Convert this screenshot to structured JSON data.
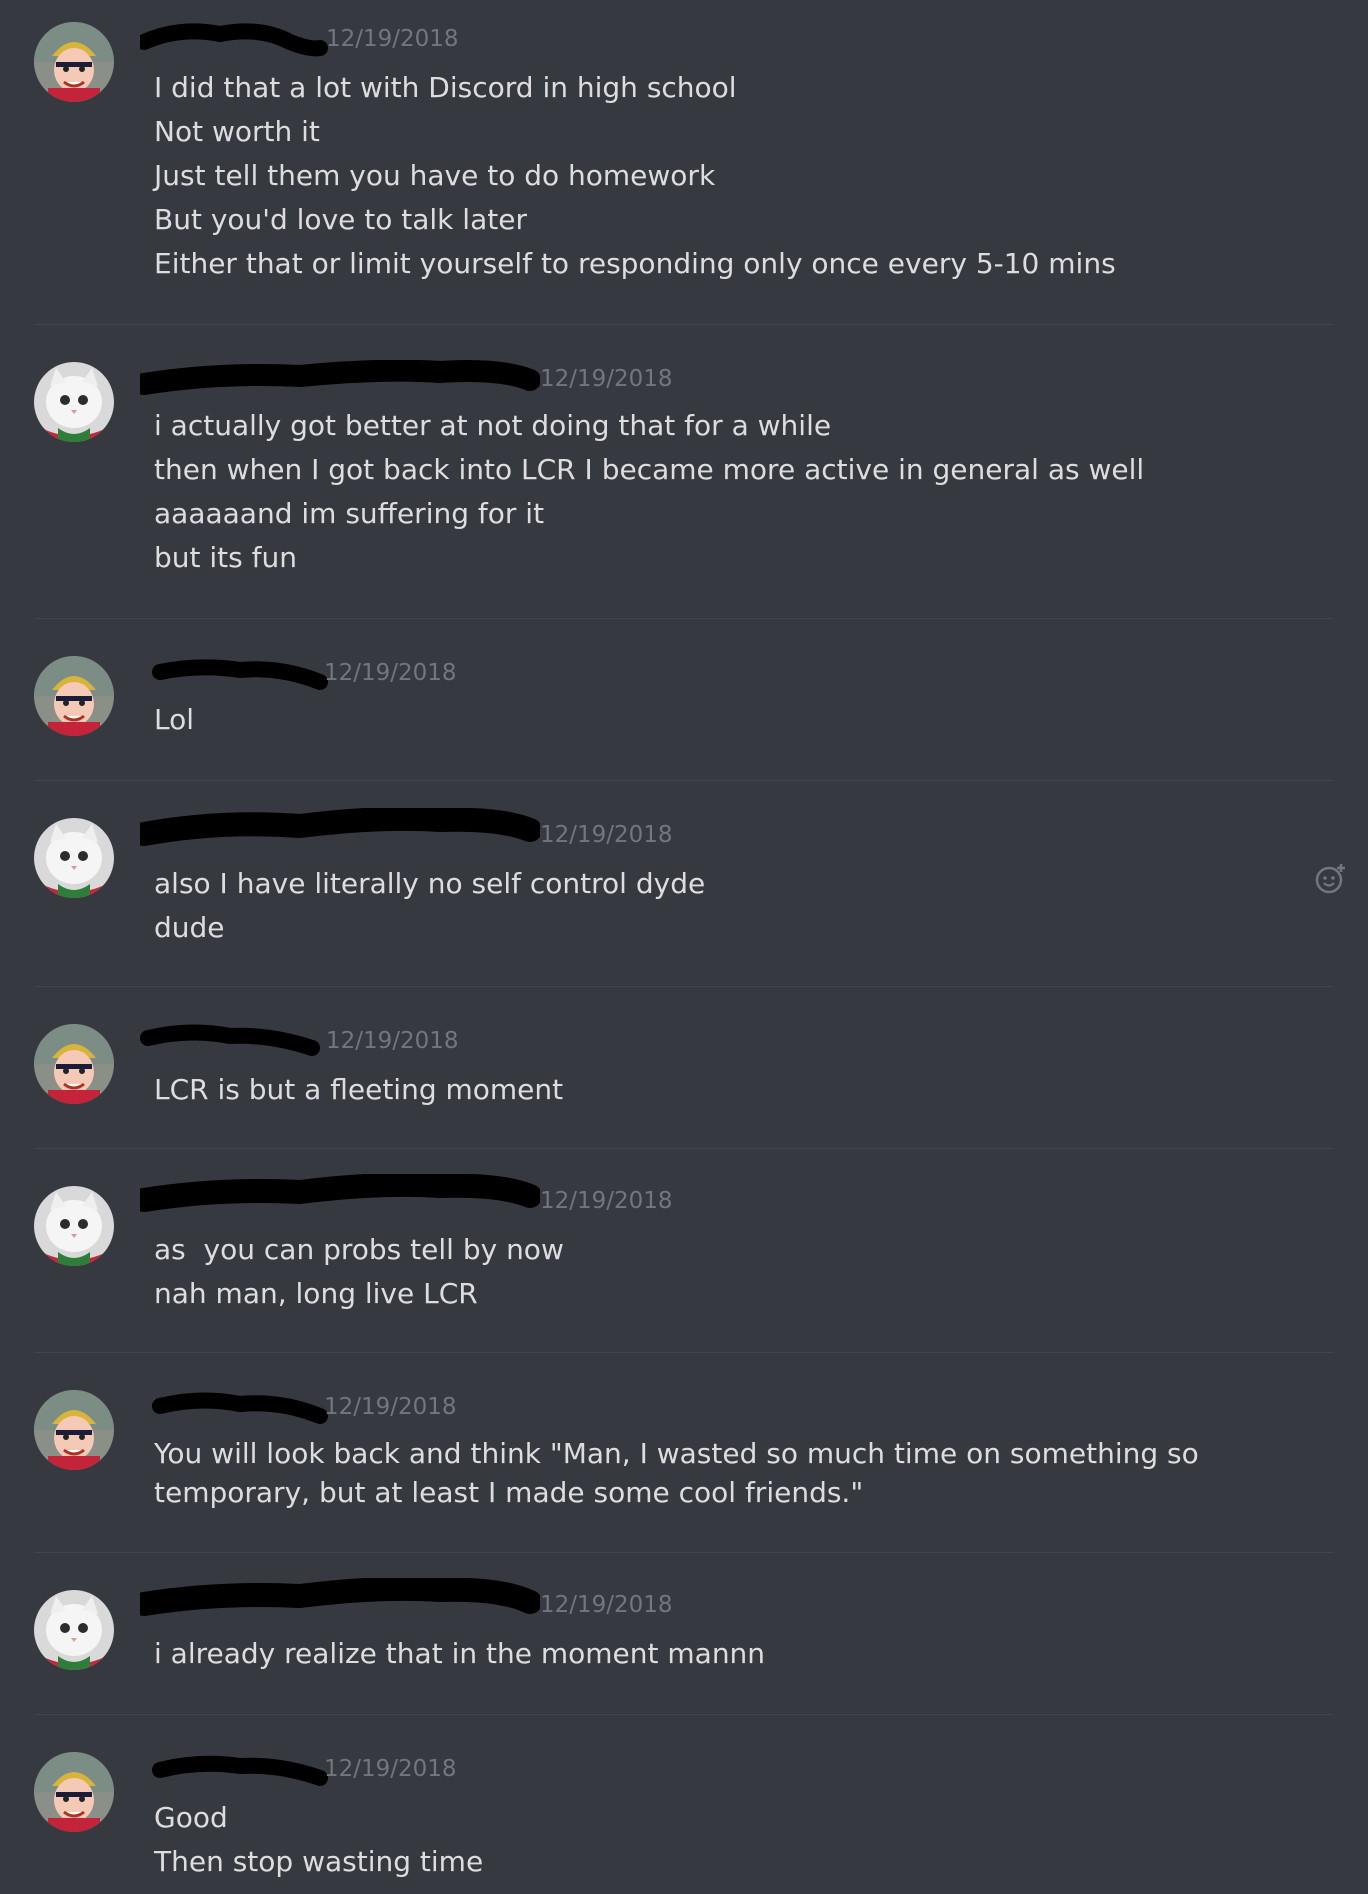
{
  "messages": [
    {
      "author": "cat-user",
      "avatar": "beanie-cartoon-avatar",
      "timestamp": "12/19/2018",
      "lines": [
        "I did that a lot with Discord in high school",
        "Not worth it",
        "Just tell them you have to do homework",
        "But you'd love to talk later",
        "Either that or limit yourself to responding only once every 5-10 mins"
      ]
    },
    {
      "author": "other-user",
      "avatar": "white-cat-avatar",
      "timestamp": "12/19/2018",
      "lines": [
        "i actually got better at not doing that for a while",
        "then when I got back into LCR I became more active in general as well",
        "aaaaaand im suffering for it",
        "but its fun"
      ]
    },
    {
      "author": "cat-user",
      "avatar": "beanie-cartoon-avatar",
      "timestamp": "12/19/2018",
      "lines": [
        "Lol"
      ]
    },
    {
      "author": "other-user",
      "avatar": "white-cat-avatar",
      "timestamp": "12/19/2018",
      "lines": [
        "also I have literally no self control dyde",
        "dude"
      ]
    },
    {
      "author": "cat-user",
      "avatar": "beanie-cartoon-avatar",
      "timestamp": "12/19/2018",
      "lines": [
        "LCR is but a fleeting moment"
      ]
    },
    {
      "author": "other-user",
      "avatar": "white-cat-avatar",
      "timestamp": "12/19/2018",
      "lines": [
        "as  you can probs tell by now",
        "nah man, long live LCR"
      ]
    },
    {
      "author": "cat-user",
      "avatar": "beanie-cartoon-avatar",
      "timestamp": "12/19/2018",
      "lines": [
        "You will look back and think \"Man, I wasted so much time on something so temporary, but at least I made some cool friends.\""
      ]
    },
    {
      "author": "other-user",
      "avatar": "white-cat-avatar",
      "timestamp": "12/19/2018",
      "lines": [
        "i already realize that in the moment mannn"
      ]
    },
    {
      "author": "cat-user",
      "avatar": "beanie-cartoon-avatar",
      "timestamp": "12/19/2018",
      "lines": [
        "Good",
        "Then stop wasting time"
      ]
    }
  ],
  "colors": {
    "background": "#36393f",
    "text": "#dcddde",
    "timestamp": "#72767d",
    "divider": "#42454a"
  },
  "icons": {
    "add_reaction": "add-reaction-icon"
  }
}
